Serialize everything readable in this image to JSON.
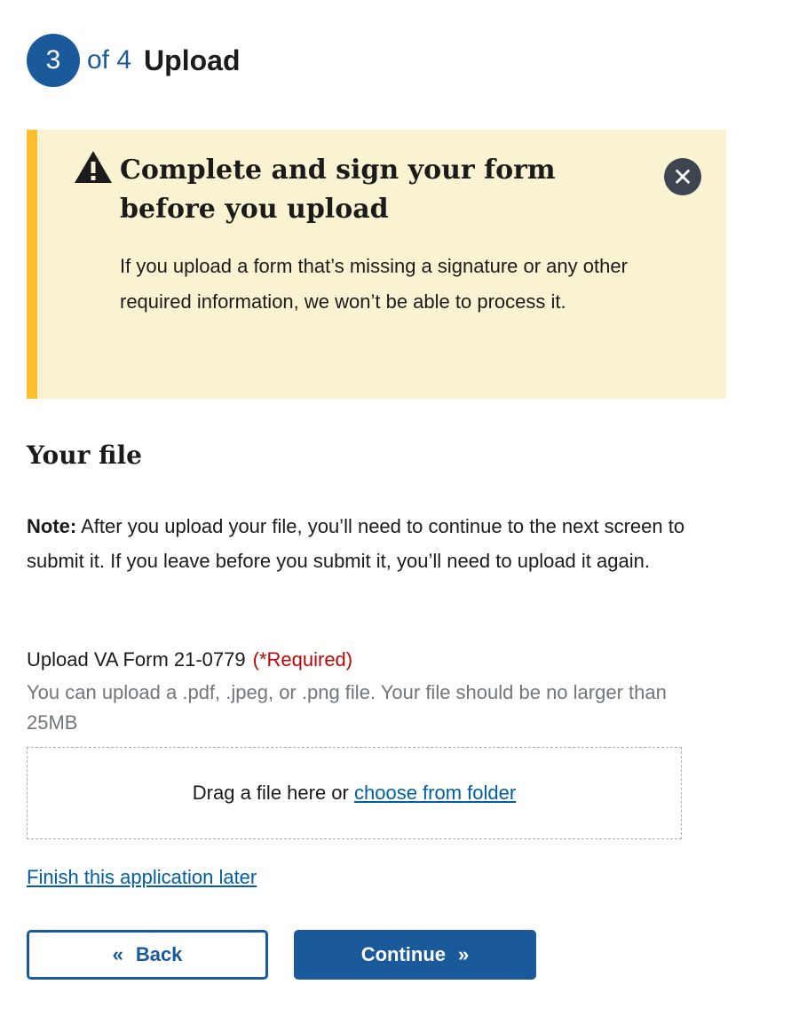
{
  "step": {
    "number": "3",
    "of": "of 4",
    "title": "Upload"
  },
  "alert": {
    "icon": "warning-icon",
    "heading": "Complete and sign your form before you upload",
    "body": "If you upload a form that’s missing a signature or any other required information, we won’t be able to process it.",
    "close_icon": "✕"
  },
  "file": {
    "heading": "Your file",
    "note_label": "Note:",
    "note_text": " After you upload your file, you’ll need to continue to the next screen to submit it. If you leave before you submit it, you’ll need to upload it again.",
    "upload_label": "Upload VA Form 21-0779",
    "required": "(*Required)",
    "hint": "You can upload a .pdf, .jpeg, or .png file. Your file should be no larger than 25MB",
    "drop_text": "Drag a file here or ",
    "drop_link": "choose from folder"
  },
  "finish_later": "Finish this application later",
  "buttons": {
    "back": "Back",
    "back_icon": "«",
    "continue": "Continue",
    "continue_icon": "»"
  },
  "colors": {
    "primary": "#1a5a9b",
    "alert_bg": "#faf3d1",
    "alert_border": "#ffbe2e",
    "required": "#b50909"
  }
}
